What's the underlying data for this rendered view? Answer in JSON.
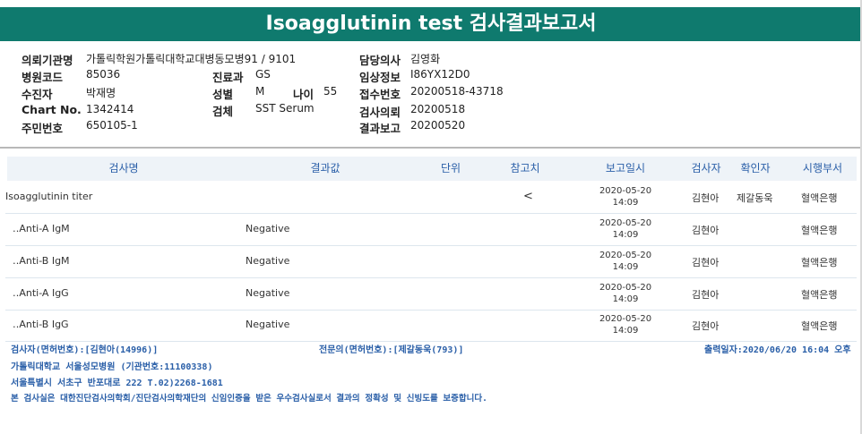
{
  "title": "Isoagglutinin test 검사결과보고서",
  "info": {
    "institution": {
      "label": "의뢰기관명",
      "value": "가톨릭학원가톨릭대학교대병동모병91 / 9101"
    },
    "hospital_code": {
      "label": "병원코드",
      "value": "85036"
    },
    "collector": {
      "label": "수진자",
      "value": "박재명"
    },
    "chart_no": {
      "label": "Chart No.",
      "value": "1342414"
    },
    "resident_no": {
      "label": "주민번호",
      "value": "650105-1"
    },
    "department": {
      "label": "진료과",
      "value": "GS"
    },
    "sex": {
      "label": "성별",
      "value": "M"
    },
    "age": {
      "label": "나이",
      "value": "55"
    },
    "specimen": {
      "label": "검체",
      "value": "SST Serum"
    },
    "doctor": {
      "label": "담당의사",
      "value": "김영화"
    },
    "clinical_info": {
      "label": "임상정보",
      "value": "I86YX12D0"
    },
    "receipt_no": {
      "label": "접수번호",
      "value": "20200518-43718"
    },
    "request_date": {
      "label": "검사의뢰",
      "value": "20200518"
    },
    "report_date": {
      "label": "결과보고",
      "value": "20200520"
    }
  },
  "table": {
    "headers": {
      "test_name": "검사명",
      "result": "결과값",
      "unit": "단위",
      "reference": "참고치",
      "report_time": "보고일시",
      "tester": "검사자",
      "verifier": "확인자",
      "performer": "시행부서"
    },
    "rows": [
      {
        "name": "Isoagglutinin titer",
        "result": "",
        "reference": "<",
        "date": "2020-05-20",
        "time": "14:09",
        "tester": "김현아",
        "verifier": "제갈동욱",
        "dept": "혈액은행"
      },
      {
        "name": "‥Anti-A IgM",
        "result": "Negative",
        "reference": "",
        "date": "2020-05-20",
        "time": "14:09",
        "tester": "김현아",
        "verifier": "",
        "dept": "혈액은행"
      },
      {
        "name": "‥Anti-B IgM",
        "result": "Negative",
        "reference": "",
        "date": "2020-05-20",
        "time": "14:09",
        "tester": "김현아",
        "verifier": "",
        "dept": "혈액은행"
      },
      {
        "name": "‥Anti-A IgG",
        "result": "Negative",
        "reference": "",
        "date": "2020-05-20",
        "time": "14:09",
        "tester": "김현아",
        "verifier": "",
        "dept": "혈액은행"
      },
      {
        "name": "‥Anti-B IgG",
        "result": "Negative",
        "reference": "",
        "date": "2020-05-20",
        "time": "14:09",
        "tester": "김현아",
        "verifier": "",
        "dept": "혈액은행"
      }
    ]
  },
  "footer": {
    "tester_license": "검사자(면허번호):[김현아(14996)]",
    "specialist_license": "전문의(면허번호):[제갈동욱(793)]",
    "print_date": "출력일자:2020/06/20 16:04 오후",
    "hospital": "가톨릭대학교 서울성모병원 (기관번호:11100338)",
    "address": "서울특별시 서초구 반포대로 222 T.02)2268-1681",
    "certification": "본 검사실은 대한진단검사의학회/진단검사의학재단의 신임인증을 받은 우수검사실로서 결과의 정확성 및 신빙도를 보증합니다."
  },
  "colors": {
    "title_bg": "#0f7a6e",
    "header_text": "#2a5fa8",
    "footer_text": "#2a5fa8"
  }
}
